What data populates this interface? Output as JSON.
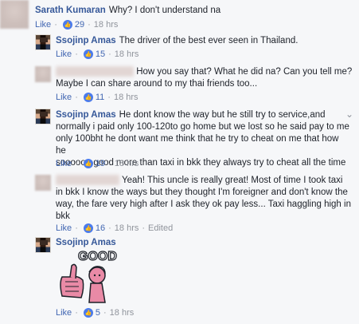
{
  "comments": [
    {
      "author": "Sarath Kumaran",
      "text": "Why? I don't understand na",
      "like": "Like",
      "reactions": "29",
      "time": "18 hrs"
    },
    {
      "author": "Ssojinp Amas",
      "text": "The driver of the best ever seen in Thailand.",
      "like": "Like",
      "reactions": "15",
      "time": "18 hrs"
    },
    {
      "author": "",
      "text_line1": "How you say that? What he did na? Can you tell me?",
      "text_line2": "Maybe I can share around to my thai friends too...",
      "like": "Like",
      "reactions": "11",
      "time": "18 hrs"
    },
    {
      "author": "Ssojinp Amas",
      "text_line1": "He dont know the way but he still try to service,and",
      "text_line2": "normally i paid only 100-120to go home but we lost so he said pay to me",
      "text_line3": "only 100bht he dont want me think that he try to cheat on me that how he",
      "text_line4": "soooooo good more than taxi in bkk they always try to cheat all the time",
      "like": "Like",
      "reactions": "19",
      "time": "18 hrs"
    },
    {
      "author": "",
      "text_line1": "Yeah! This uncle is really great! Most of time I took taxi",
      "text_line2": "in bkk I know the ways but they thought I'm foreigner and don't know the",
      "text_line3": "way, the fare very high after I ask they ok pay less... Taxi haggling high in",
      "text_line4": "bkk",
      "like": "Like",
      "reactions": "16",
      "time": "18 hrs",
      "edited": "Edited"
    },
    {
      "author": "Ssojinp Amas",
      "sticker_text": "GOOD",
      "like": "Like",
      "reactions": "5",
      "time": "18 hrs"
    }
  ],
  "colors": {
    "link": "#365899",
    "meta": "#90949c",
    "reaction": "#4b7bec",
    "background": "#f6f7f9"
  },
  "icons": {
    "reaction": "thumbs-up-icon",
    "more": "chevron-down-icon"
  }
}
